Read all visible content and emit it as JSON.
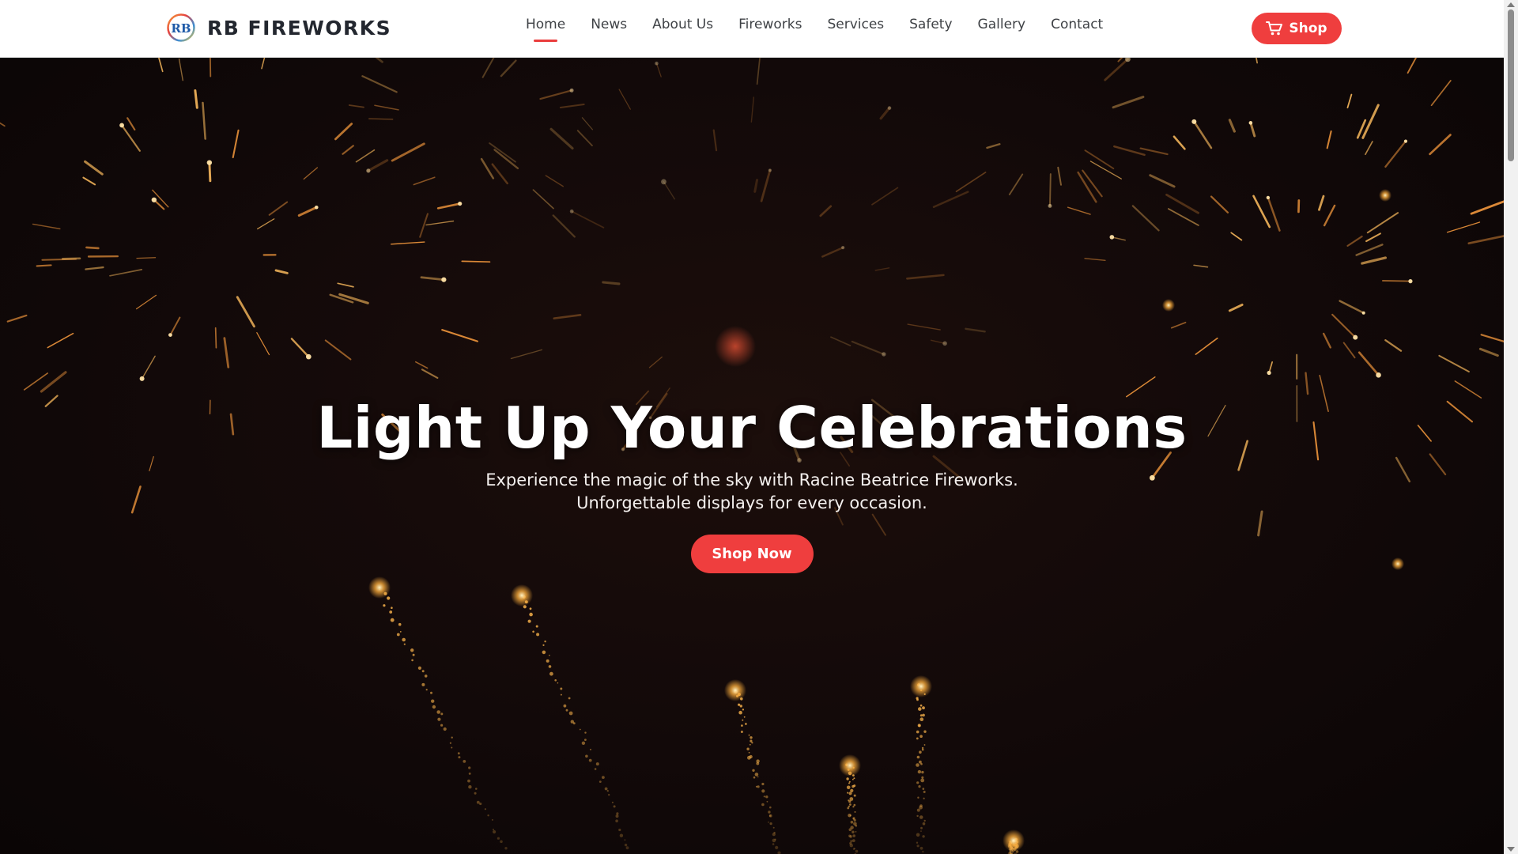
{
  "brand": {
    "logo_icon": "rb-logo-icon",
    "logo_text": "RB",
    "name": "RB FIREWORKS"
  },
  "nav": {
    "items": [
      {
        "label": "Home",
        "active": true
      },
      {
        "label": "News"
      },
      {
        "label": "About Us"
      },
      {
        "label": "Fireworks"
      },
      {
        "label": "Services"
      },
      {
        "label": "Safety"
      },
      {
        "label": "Gallery"
      },
      {
        "label": "Contact"
      }
    ],
    "shop_label": "Shop",
    "shop_icon": "cart-icon"
  },
  "hero": {
    "title": "Light Up Your Celebrations",
    "subtitle_line1": "Experience the magic of the sky with Racine Beatrice Fireworks.",
    "subtitle_line2": "Unforgettable displays for every occasion.",
    "cta_label": "Shop Now"
  },
  "colors": {
    "accent": "#ef3e3e",
    "header_bg": "#ffffff",
    "hero_bg": "#120909",
    "spark": "#f0a640"
  }
}
